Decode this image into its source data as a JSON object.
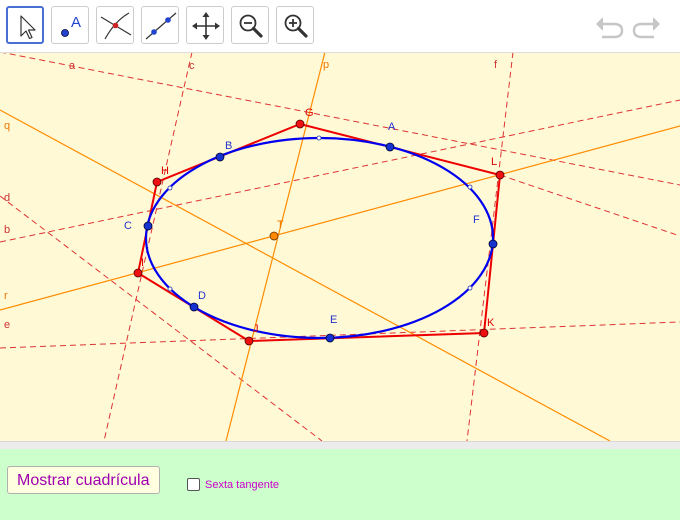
{
  "toolbar": {
    "tools": [
      "move-tool",
      "point-tool",
      "intersect-tool",
      "point-on-object-tool",
      "move-graphics-view-tool",
      "zoom-out-tool",
      "zoom-in-tool"
    ],
    "selected": "move-tool",
    "point_tool_letter": "A",
    "history": [
      "undo",
      "redo"
    ]
  },
  "graphics": {
    "point_labels": {
      "A": "A",
      "B": "B",
      "C": "C",
      "D": "D",
      "E": "E",
      "F": "F",
      "G": "G",
      "H": "H",
      "I": "I",
      "J": "J",
      "K": "K",
      "L": "L",
      "T": "T"
    },
    "line_labels": {
      "a": "a",
      "b": "b",
      "c": "c",
      "d": "d",
      "e": "e",
      "f": "f",
      "p": "p",
      "q": "q",
      "r": "r"
    },
    "colors": {
      "background": "#fff9d6",
      "ellipse": "#0000ee",
      "polygon": "#ee0000",
      "dashed_lines": "#dd3333",
      "orange_lines": "#ff8c00",
      "blue_points": "#1533d0",
      "red_points": "#ee1111",
      "center_point": "#ff8800"
    }
  },
  "bottom": {
    "grid_button": "Mostrar cuadrícula",
    "checkbox": {
      "label": "Sexta tangente",
      "checked": false
    }
  }
}
